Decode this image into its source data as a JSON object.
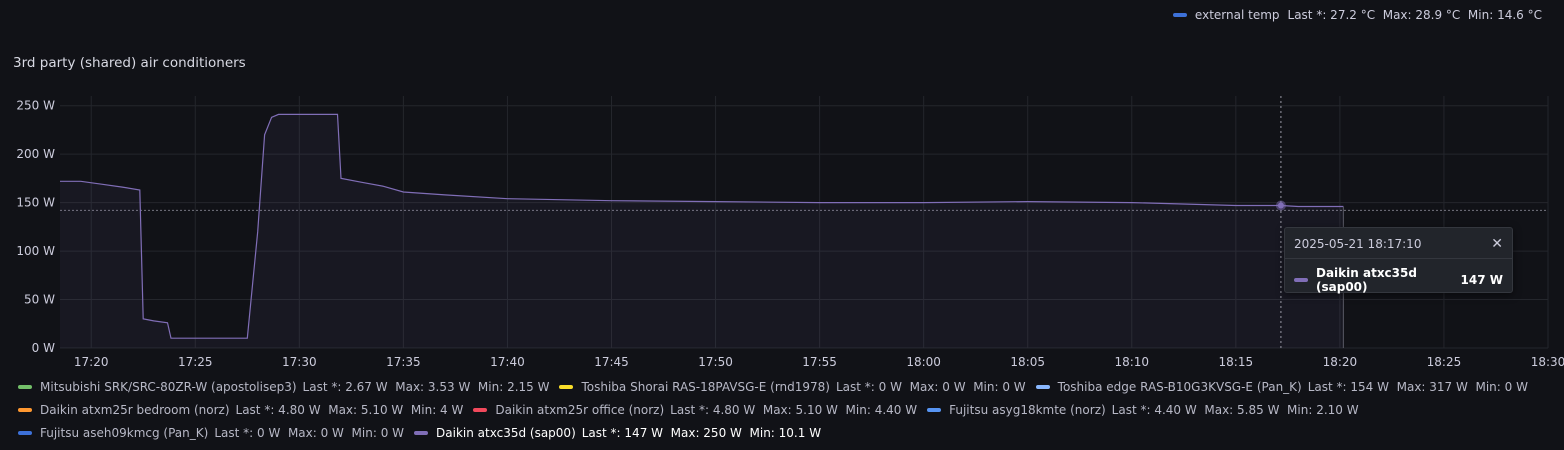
{
  "top_legend": {
    "name": "external temp",
    "color": "#3d71d9",
    "stats": "Last *: 27.2 °C  Max: 28.9 °C  Min: 14.6 °C"
  },
  "panel": {
    "title": "3rd party (shared) air conditioners"
  },
  "tooltip": {
    "time": "2025-05-21 18:17:10",
    "series_name": "Daikin atxc35d (sap00)",
    "value": "147 W",
    "color": "#806eb7",
    "close_icon": "close-icon"
  },
  "chart_data": {
    "type": "line",
    "x_unit": "time",
    "y_unit": "W",
    "ylim": [
      0,
      260
    ],
    "yticks": [
      0,
      50,
      100,
      150,
      200,
      250
    ],
    "ytick_labels": [
      "0 W",
      "50 W",
      "100 W",
      "150 W",
      "200 W",
      "250 W"
    ],
    "xlim": [
      "17:18:30",
      "18:30:00"
    ],
    "xticks": [
      "17:20",
      "17:25",
      "17:30",
      "17:35",
      "17:40",
      "17:45",
      "17:50",
      "17:55",
      "18:00",
      "18:05",
      "18:10",
      "18:15",
      "18:20",
      "18:25",
      "18:30"
    ],
    "grid": true,
    "hover_time": "18:17:10",
    "threshold_line": 142,
    "series": [
      {
        "name": "Daikin atxc35d (sap00)",
        "color": "#806eb7",
        "points": [
          [
            "17:18:30",
            172
          ],
          [
            "17:19:30",
            172
          ],
          [
            "17:20:30",
            169
          ],
          [
            "17:21:30",
            166
          ],
          [
            "17:22:20",
            163
          ],
          [
            "17:22:30",
            30
          ],
          [
            "17:23:00",
            28
          ],
          [
            "17:23:40",
            26
          ],
          [
            "17:23:50",
            10.1
          ],
          [
            "17:27:30",
            10.1
          ],
          [
            "17:28:00",
            120
          ],
          [
            "17:28:20",
            220
          ],
          [
            "17:28:40",
            238
          ],
          [
            "17:29:00",
            241
          ],
          [
            "17:31:50",
            241
          ],
          [
            "17:32:00",
            175
          ],
          [
            "17:33:00",
            171
          ],
          [
            "17:34:00",
            167
          ],
          [
            "17:35:00",
            161
          ],
          [
            "17:37:00",
            158
          ],
          [
            "17:40:00",
            154
          ],
          [
            "17:45:00",
            152
          ],
          [
            "17:50:00",
            151
          ],
          [
            "17:55:00",
            150
          ],
          [
            "18:00:00",
            150
          ],
          [
            "18:05:00",
            151
          ],
          [
            "18:10:00",
            150
          ],
          [
            "18:15:00",
            147
          ],
          [
            "18:17:10",
            147
          ],
          [
            "18:18:00",
            146
          ],
          [
            "18:20:10",
            146
          ]
        ]
      }
    ]
  },
  "legend": [
    {
      "name": "Mitsubishi SRK/SRC-80ZR-W (apostolisep3)",
      "color": "#73bf69",
      "stats": "Last *: 2.67 W  Max: 3.53 W  Min: 2.15 W",
      "active": false
    },
    {
      "name": "Toshiba Shorai RAS-18PAVSG-E (rnd1978)",
      "color": "#fade2a",
      "stats": "Last *: 0 W  Max: 0 W  Min: 0 W",
      "active": false
    },
    {
      "name": "Toshiba edge RAS-B10G3KVSG-E (Pan_K)",
      "color": "#8ab8ff",
      "stats": "Last *: 154 W  Max: 317 W  Min: 0 W",
      "active": false
    },
    {
      "name": "Daikin atxm25r bedroom (norz)",
      "color": "#ff9830",
      "stats": "Last *: 4.80 W  Max: 5.10 W  Min: 4 W",
      "active": false
    },
    {
      "name": "Daikin atxm25r office (norz)",
      "color": "#f2495c",
      "stats": "Last *: 4.80 W  Max: 5.10 W  Min: 4.40 W",
      "active": false
    },
    {
      "name": "Fujitsu asyg18kmte (norz)",
      "color": "#5794f2",
      "stats": "Last *: 4.40 W  Max: 5.85 W  Min: 2.10 W",
      "active": false
    },
    {
      "name": "Fujitsu aseh09kmcg (Pan_K)",
      "color": "#3d71d9",
      "stats": "Last *: 0 W  Max: 0 W  Min: 0 W",
      "active": false
    },
    {
      "name": "Daikin atxc35d (sap00)",
      "color": "#806eb7",
      "stats": "Last *: 147 W  Max: 250 W  Min: 10.1 W",
      "active": true
    }
  ]
}
